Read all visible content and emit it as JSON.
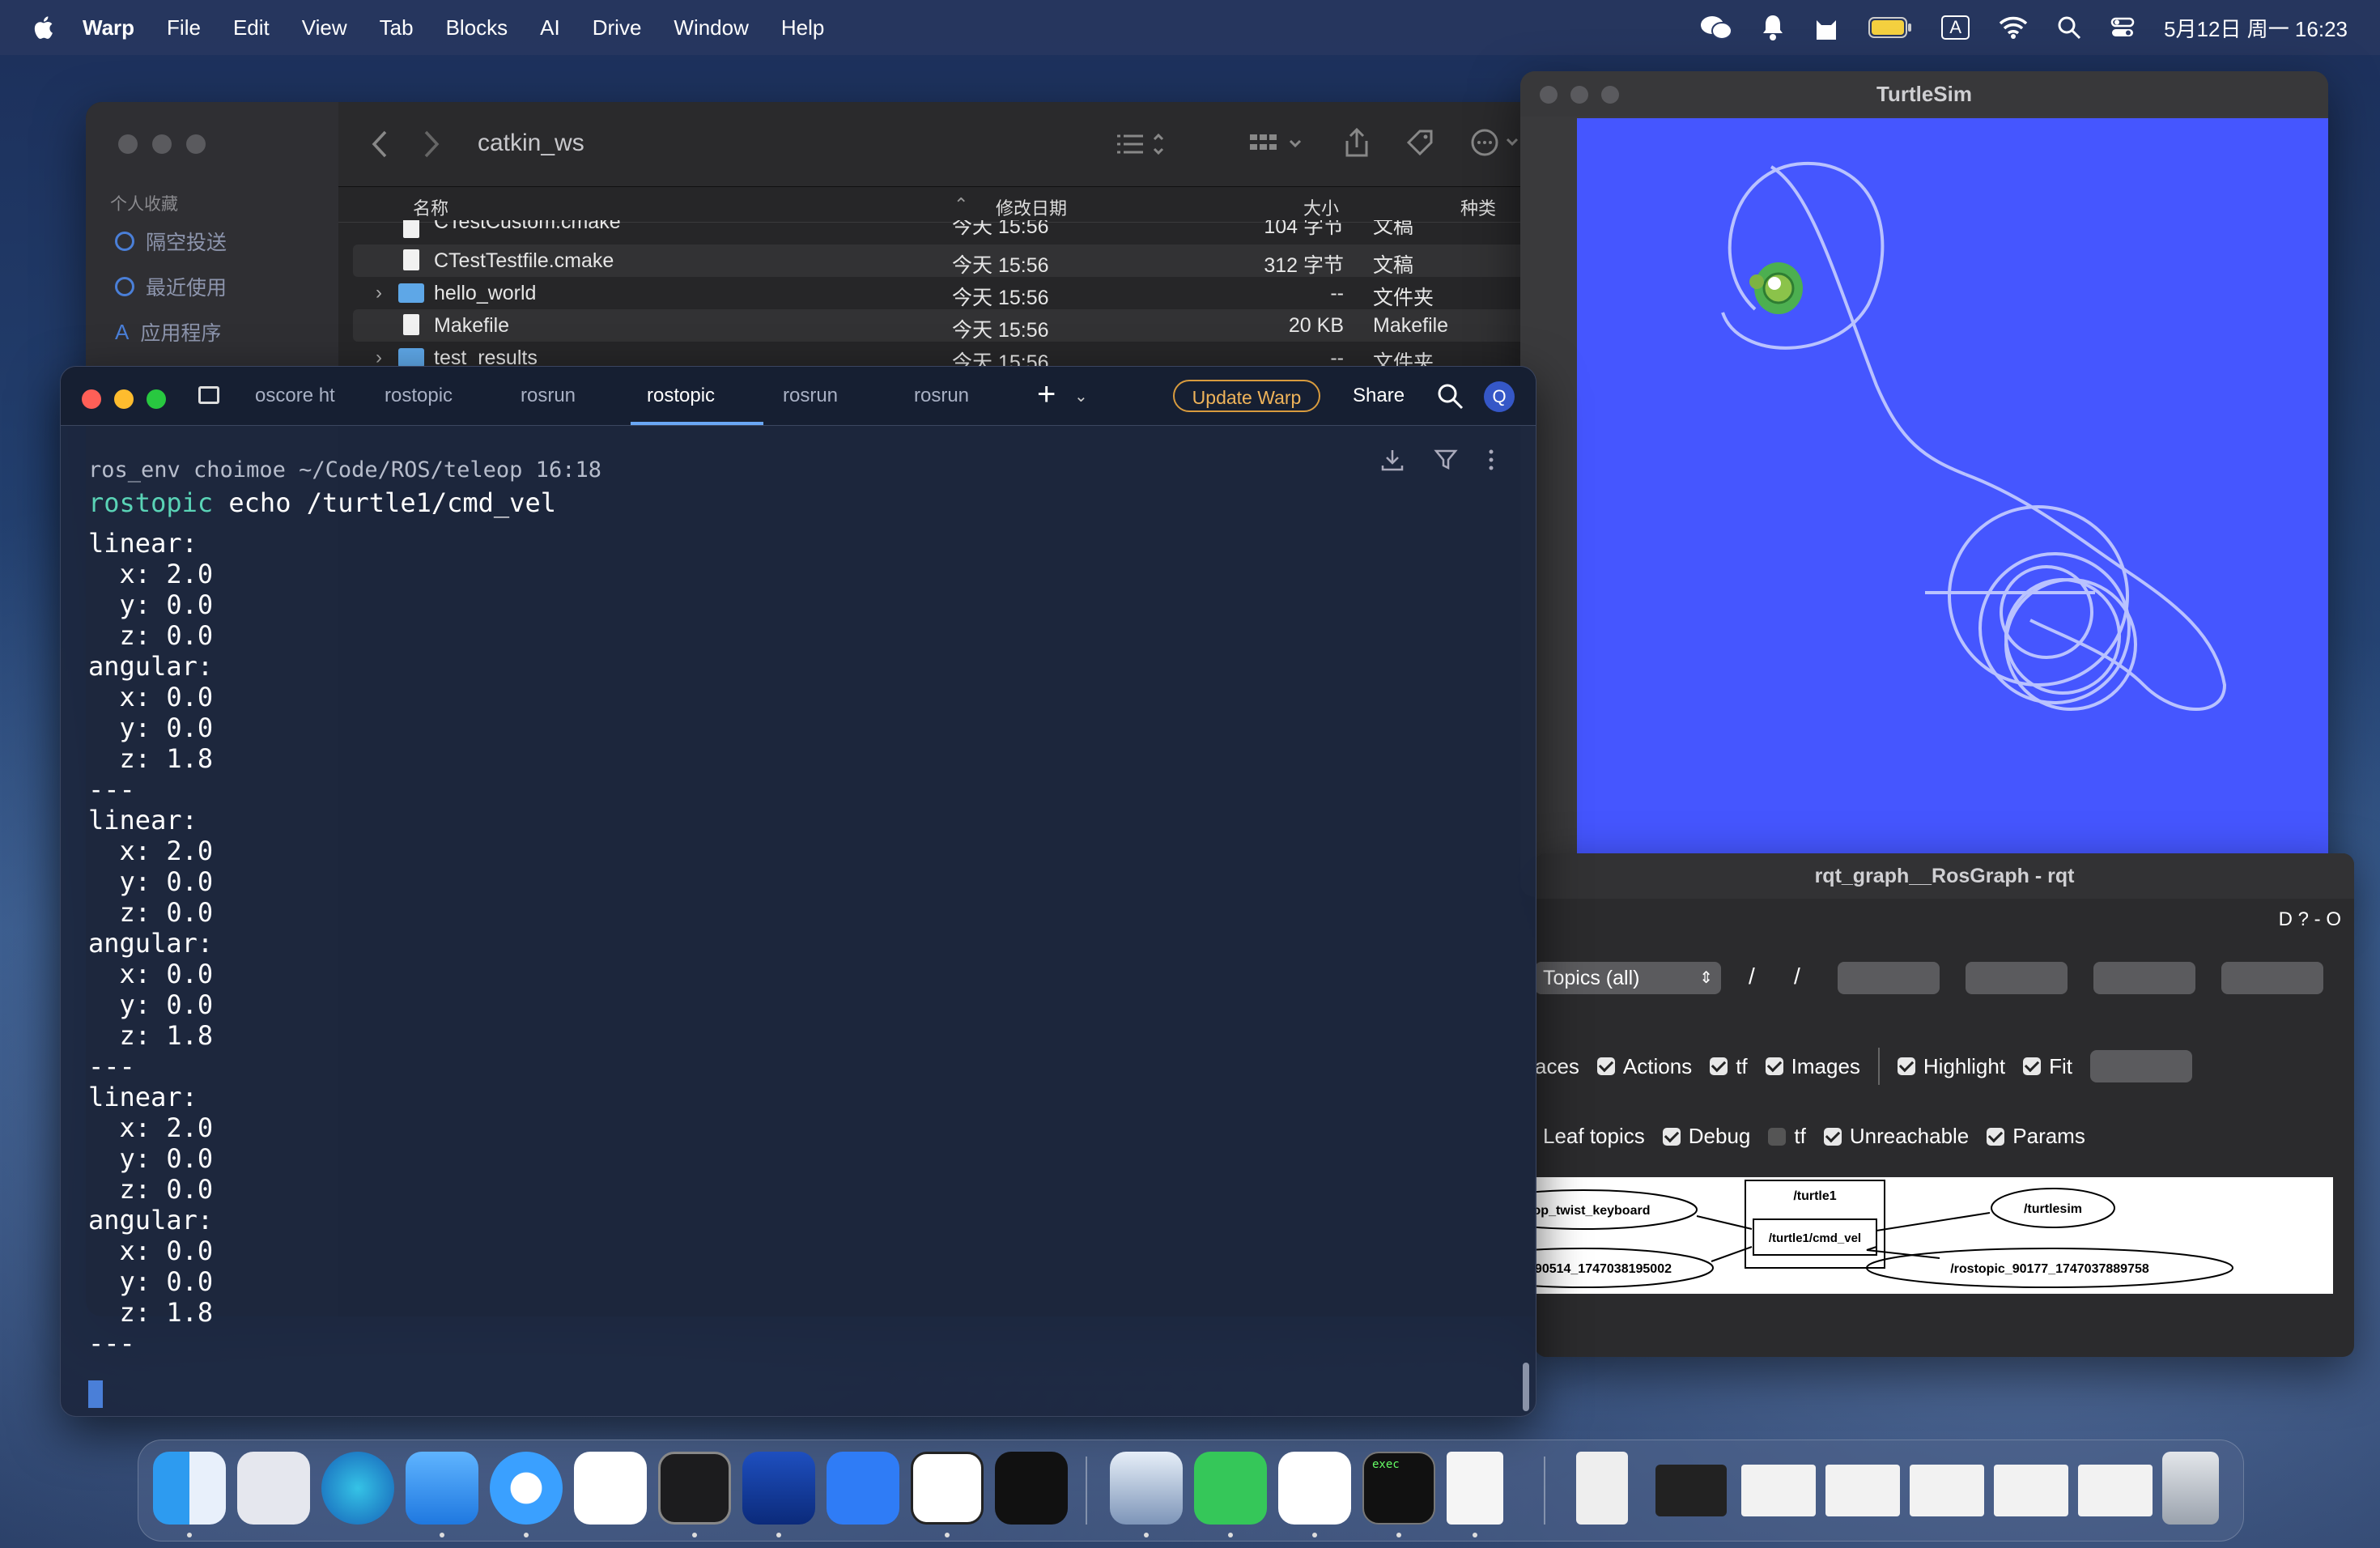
{
  "menubar": {
    "app": "Warp",
    "items": [
      "File",
      "Edit",
      "View",
      "Tab",
      "Blocks",
      "AI",
      "Drive",
      "Window",
      "Help"
    ],
    "clock": "5月12日 周一 16:23",
    "input_badge": "A"
  },
  "finder": {
    "title": "catkin_ws",
    "sidebar": {
      "section": "个人收藏",
      "items": [
        "隔空投送",
        "最近使用",
        "应用程序"
      ]
    },
    "columns": {
      "name": "名称",
      "date": "修改日期",
      "size": "大小",
      "kind": "种类"
    },
    "rows": [
      {
        "name": "CTestCustom.cmake",
        "date": "今天 15:56",
        "size": "104 字节",
        "kind": "文稿"
      },
      {
        "name": "CTestTestfile.cmake",
        "date": "今天 15:56",
        "size": "312 字节",
        "kind": "文稿"
      },
      {
        "name": "hello_world",
        "date": "今天 15:56",
        "size": "--",
        "kind": "文件夹"
      },
      {
        "name": "Makefile",
        "date": "今天 15:56",
        "size": "20 KB",
        "kind": "Makefile"
      },
      {
        "name": "test_results",
        "date": "今天 15:56",
        "size": "--",
        "kind": "文件夹"
      }
    ]
  },
  "turtlesim": {
    "title": "TurtleSim",
    "bg": "#4556ff"
  },
  "rqt": {
    "title": "rqt_graph__RosGraph - rqt",
    "toolbar_right": "D ?   - O",
    "combo": "Topics (all)",
    "slash1": "/",
    "slash2": "/",
    "row1": [
      {
        "label": "aces",
        "checkbox": false
      },
      {
        "label": "Actions",
        "checked": true
      },
      {
        "label": "tf",
        "checked": true
      },
      {
        "label": "Images",
        "checked": true
      },
      {
        "label": "Highlight",
        "checked": true
      },
      {
        "label": "Fit",
        "checked": true
      }
    ],
    "row2": [
      {
        "label": "Leaf topics",
        "checkbox": false
      },
      {
        "label": "Debug",
        "checked": true
      },
      {
        "label": "tf",
        "checked": false
      },
      {
        "label": "Unreachable",
        "checked": true
      },
      {
        "label": "Params",
        "checked": true
      }
    ],
    "graph": {
      "node_keyboard": "op_twist_keyboard",
      "node_rostopic_left": "_90514_1747038195002",
      "ns": "/turtle1",
      "topic": "/turtle1/cmd_vel",
      "node_turtlesim": "/turtlesim",
      "node_rostopic_right": "/rostopic_90177_1747037889758"
    }
  },
  "warp": {
    "tabs": [
      "oscore ht",
      "rostopic",
      "rosrun",
      "rostopic",
      "rosrun",
      "rosrun"
    ],
    "active_tab_index": 3,
    "update_label": "Update Warp",
    "share_label": "Share",
    "avatar_letter": "Q",
    "prompt": "ros_env choimoe ~/Code/ROS/teleop 16:18",
    "cmd_keyword": "rostopic",
    "cmd_rest": " echo /turtle1/cmd_vel",
    "output": "linear:\n  x: 2.0\n  y: 0.0\n  z: 0.0\nangular:\n  x: 0.0\n  y: 0.0\n  z: 1.8\n---\nlinear:\n  x: 2.0\n  y: 0.0\n  z: 0.0\nangular:\n  x: 0.0\n  y: 0.0\n  z: 1.8\n---\nlinear:\n  x: 2.0\n  y: 0.0\n  z: 0.0\nangular:\n  x: 0.0\n  y: 0.0\n  z: 1.8\n---"
  },
  "dock": {
    "apps": [
      "finder-icon",
      "launchpad-icon",
      "edge-icon",
      "mail-icon",
      "safari-icon",
      "vscode-icon",
      "activity-monitor-icon",
      "warp-icon",
      "things-icon",
      "notion-icon",
      "unity-icon",
      "preview-icon",
      "wechat-icon",
      "qq-icon",
      "terminal-icon",
      "document-icon"
    ],
    "terminal_label": "exec"
  }
}
